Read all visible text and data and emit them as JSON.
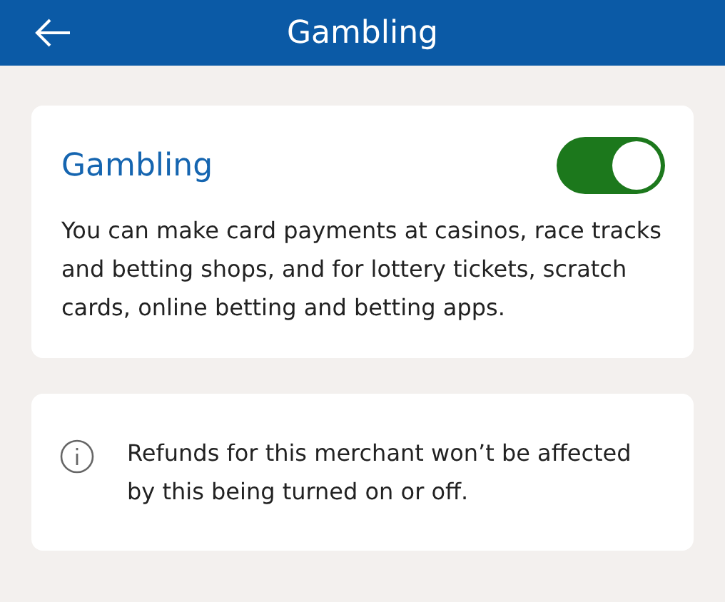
{
  "header": {
    "title": "Gambling"
  },
  "setting": {
    "title": "Gambling",
    "on": true,
    "description": "You can make card payments at casinos, race tracks and betting shops, and for lottery tickets, scratch cards, online betting and betting apps."
  },
  "info": {
    "text": "Refunds for this merchant won’t be affected by this being turned on or off."
  }
}
